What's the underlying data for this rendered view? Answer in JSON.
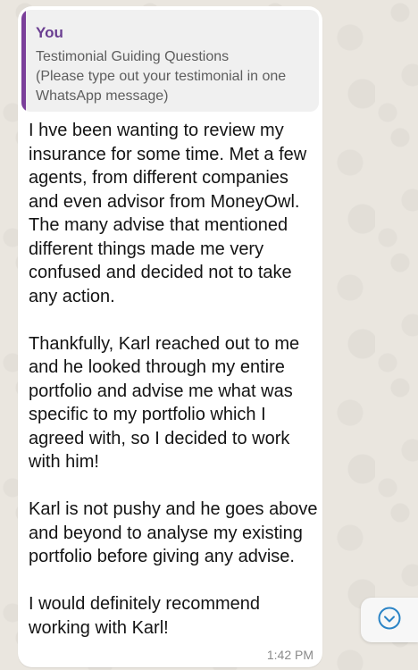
{
  "message": {
    "quoted": {
      "author": "You",
      "text": "Testimonial Guiding Questions\n(Please type out your testimonial in one WhatsApp message)"
    },
    "body": "I hve been wanting to review my insurance for some time. Met a few agents, from different companies and even advisor from MoneyOwl. The many advise that mentioned different things made me very confused and decided not to take any action.\n\nThankfully, Karl reached out to me and he looked through my entire portfolio and advise me what was specific to my portfolio which I agreed with, so I decided to work with him!\n\nKarl is not pushy and he goes above and beyond to analyse my existing portfolio before giving any advise.\n\nI would definitely recommend working with Karl!",
    "time": "1:42 PM"
  },
  "scroll_button": {
    "icon": "chevron-down-circle-icon"
  },
  "colors": {
    "accent": "#2b84c6",
    "quote_bar": "#7b3f9a",
    "quote_author": "#6a3e91"
  }
}
